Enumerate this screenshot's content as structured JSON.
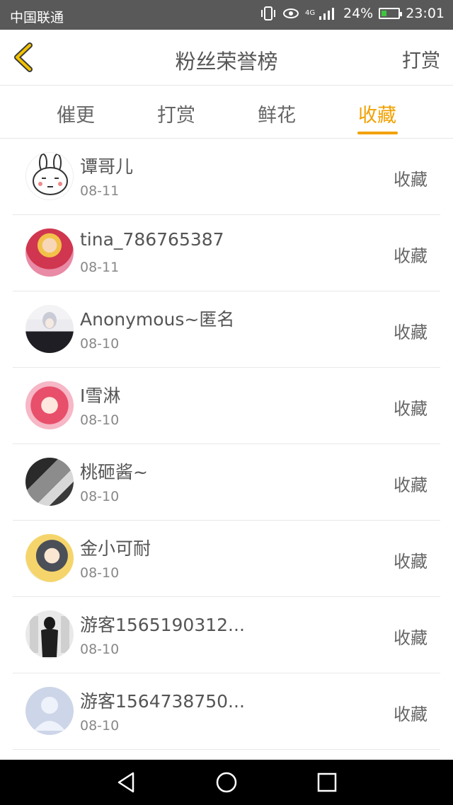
{
  "status": {
    "carrier": "中国联通",
    "network": "4G",
    "battery": "24%",
    "time": "23:01"
  },
  "header": {
    "title": "粉丝荣誉榜",
    "right_action": "打赏"
  },
  "tabs": [
    {
      "label": "催更",
      "active": false
    },
    {
      "label": "打赏",
      "active": false
    },
    {
      "label": "鲜花",
      "active": false
    },
    {
      "label": "收藏",
      "active": true
    }
  ],
  "accent_color": "#f2a100",
  "list": [
    {
      "name": "谭哥儿",
      "date": "08-11",
      "action": "收藏",
      "avatar": "rabbit-avatar-icon"
    },
    {
      "name": "tina_786765387",
      "date": "08-11",
      "action": "收藏",
      "avatar": "anime-girl-red-avatar-icon"
    },
    {
      "name": "Anonymous~匿名",
      "date": "08-10",
      "action": "收藏",
      "avatar": "anime-girl-grey-hair-avatar-icon"
    },
    {
      "name": "I雪淋",
      "date": "08-10",
      "action": "收藏",
      "avatar": "anime-girl-pink-avatar-icon"
    },
    {
      "name": "桃砸酱~",
      "date": "08-10",
      "action": "收藏",
      "avatar": "photo-monochrome-avatar-icon"
    },
    {
      "name": "金小可耐",
      "date": "08-10",
      "action": "收藏",
      "avatar": "anime-boy-avatar-icon"
    },
    {
      "name": "游客1565190312...",
      "date": "08-10",
      "action": "收藏",
      "avatar": "figure-sketch-avatar-icon"
    },
    {
      "name": "游客1564738750...",
      "date": "08-10",
      "action": "收藏",
      "avatar": "default-user-avatar-icon"
    }
  ]
}
